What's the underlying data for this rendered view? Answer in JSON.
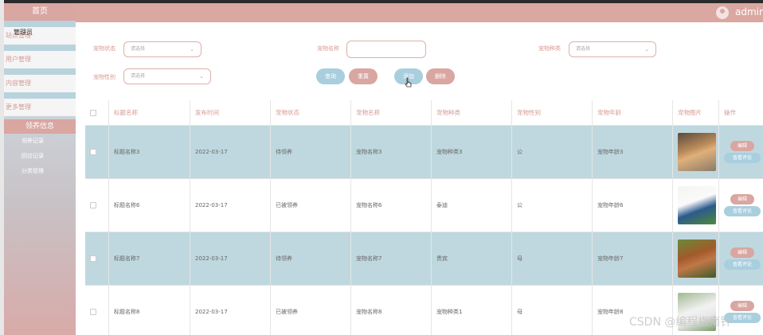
{
  "sidebar": {
    "home": "首页",
    "items": [
      {
        "label": "站点管理",
        "overlay": "管理员"
      },
      {
        "label": "用户管理"
      },
      {
        "label": "内容管理"
      },
      {
        "label": "更多管理"
      }
    ],
    "group": "领养信息",
    "subitems": [
      "领养记录",
      "回访记录",
      "分类管理"
    ]
  },
  "header": {
    "user": "admin"
  },
  "filters": {
    "status_label": "宠物状态",
    "status_placeholder": "请选择",
    "name_label": "宠物名称",
    "type_label": "宠物种类",
    "type_placeholder": "请选择",
    "gender_label": "宠物性别",
    "gender_placeholder": "请选择",
    "buttons": {
      "query": "查询",
      "reset": "重置",
      "add": "添加",
      "delete": "删除"
    }
  },
  "table": {
    "headers": [
      "标题名称",
      "发布时间",
      "宠物状态",
      "宠物名称",
      "宠物种类",
      "宠物性别",
      "宠物年龄",
      "宠物图片",
      "操作"
    ],
    "rows": [
      {
        "title": "标题名称3",
        "date": "2022-03-17",
        "status": "待领养",
        "name": "宠物名称3",
        "type": "宠物种类3",
        "gender": "公",
        "age": "宠物年龄3"
      },
      {
        "title": "标题名称6",
        "date": "2022-03-17",
        "status": "已被领养",
        "name": "宠物名称6",
        "type": "泰迪",
        "gender": "公",
        "age": "宠物年龄6"
      },
      {
        "title": "标题名称7",
        "date": "2022-03-17",
        "status": "待领养",
        "name": "宠物名称7",
        "type": "贵宾",
        "gender": "母",
        "age": "宠物年龄7"
      },
      {
        "title": "标题名称8",
        "date": "2022-03-17",
        "status": "已被领养",
        "name": "宠物名称8",
        "type": "宠物种类1",
        "gender": "母",
        "age": "宠物年龄8"
      }
    ],
    "actions": {
      "edit": "编辑",
      "view": "查看评论"
    }
  },
  "watermark": "CSDN @编程指南针"
}
